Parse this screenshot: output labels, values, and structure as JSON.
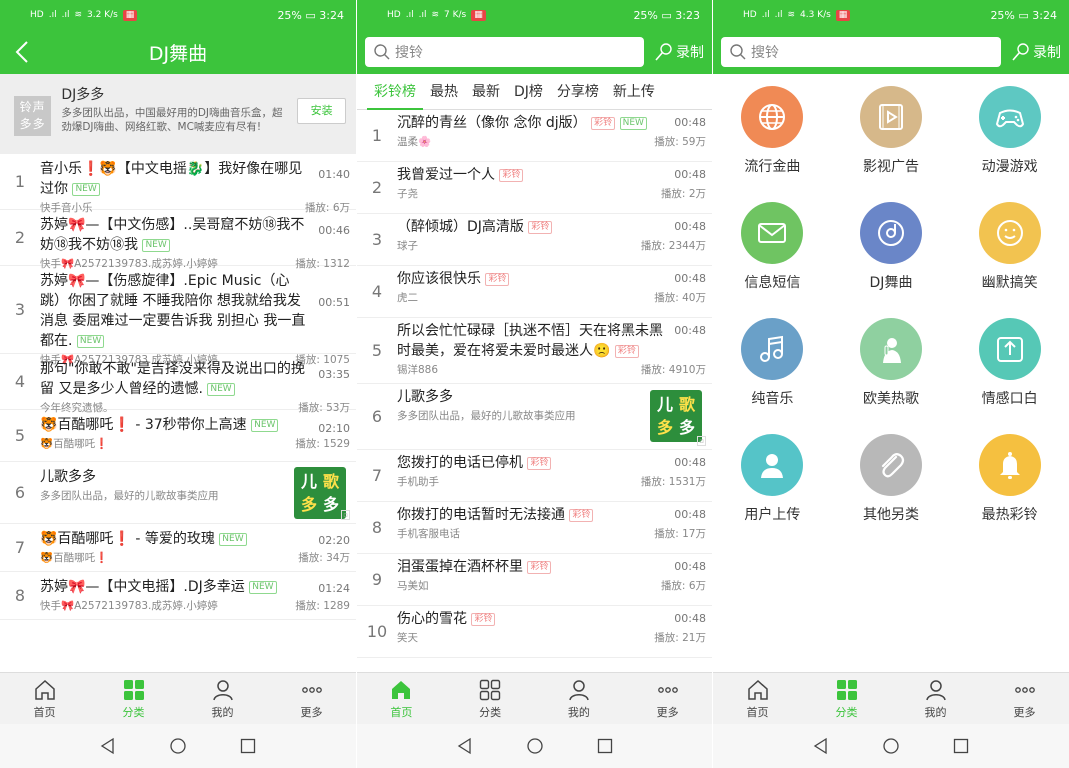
{
  "colors": {
    "brand": "#3cc43c",
    "tag_new": "#6cc46c",
    "tag_ringtone": "#f07f7f"
  },
  "statusbar": {
    "s1": {
      "speed": "3.2 K/s",
      "battery": "25%",
      "time": "3:24"
    },
    "s2": {
      "speed": "7 K/s",
      "battery": "25%",
      "time": "3:23"
    },
    "s3": {
      "speed": "4.3 K/s",
      "battery": "25%",
      "time": "3:24"
    }
  },
  "screen1": {
    "title": "DJ舞曲",
    "promo": {
      "logo_text": "铃声多多",
      "title": "DJ多多",
      "desc": "多多团队出品，中国最好用的DJ嗨曲音乐盒，超劲爆DJ嗨曲、网络红歌、MC喊麦应有尽有!",
      "install": "安装"
    },
    "items": [
      {
        "num": "1",
        "title": "音小乐❗🐯【中文电摇🐉】我好像在哪见过你",
        "tag": "NEW",
        "artist": "快手音小乐",
        "plays": "播放: 6万",
        "duration": "01:40"
      },
      {
        "num": "2",
        "title": "苏婷🎀—【中文伤感】..吴哥窟不妨⑱我不妨⑱我不妨⑱我",
        "tag": "NEW",
        "artist": "快手🎀A2572139783.成苏婷.小婷婷",
        "plays": "播放: 1312",
        "duration": "00:46"
      },
      {
        "num": "3",
        "title": "苏婷🎀—【伤感旋律】.Epic Music（心跳）你困了就睡 不睡我陪你 想我就给我发消息 委屈难过一定要告诉我 别担心 我一直都在.",
        "tag": "NEW",
        "artist": "快手🎀A2572139783.成苏婷.小婷婷",
        "plays": "播放: 1075",
        "duration": "00:51"
      },
      {
        "num": "4",
        "title": "那句\"你敢不敢\"是吉择没来得及说出口的挽留 又是多少人曾经的遗憾.",
        "tag": "NEW",
        "artist": "今年终究遗憾。",
        "plays": "播放: 53万",
        "duration": "03:35"
      },
      {
        "num": "5",
        "title": "🐯百酷哪吒❗ - 37秒带你上高速",
        "tag": "NEW",
        "artist": "🐯百酷哪吒❗",
        "plays": "播放: 1529",
        "duration": "02:10"
      },
      {
        "num": "6",
        "title": "儿歌多多",
        "tag": "",
        "artist": "多多团队出品，最好的儿歌故事类应用",
        "plays": "",
        "duration": "",
        "ad": true
      },
      {
        "num": "7",
        "title": "🐯百酷哪吒❗ - 等爱的玫瑰",
        "tag": "NEW",
        "artist": "🐯百酷哪吒❗",
        "plays": "播放: 34万",
        "duration": "02:20"
      },
      {
        "num": "8",
        "title": "苏婷🎀—【中文电摇】.DJ多幸运",
        "tag": "NEW",
        "artist": "快手🎀A2572139783.成苏婷.小婷婷",
        "plays": "播放: 1289",
        "duration": "01:24"
      }
    ]
  },
  "search": {
    "placeholder": "搜铃",
    "record": "录制"
  },
  "screen2": {
    "tabs": [
      "彩铃榜",
      "最热",
      "最新",
      "DJ榜",
      "分享榜",
      "新上传"
    ],
    "items": [
      {
        "num": "1",
        "title": "沉醉的青丝（像你 念你 dj版）",
        "tags": [
          "彩铃",
          "NEW"
        ],
        "artist": "温柔🌸",
        "plays": "播放: 59万",
        "duration": "00:48"
      },
      {
        "num": "2",
        "title": "我曾爱过一个人",
        "tags": [
          "彩铃"
        ],
        "artist": "子尧",
        "plays": "播放: 2万",
        "duration": "00:48"
      },
      {
        "num": "3",
        "title": "（醉倾城）DJ高清版",
        "tags": [
          "彩铃"
        ],
        "artist": "球子",
        "plays": "播放: 2344万",
        "duration": "00:48"
      },
      {
        "num": "4",
        "title": "你应该很快乐",
        "tags": [
          "彩铃"
        ],
        "artist": "虎二",
        "plays": "播放: 40万",
        "duration": "00:48"
      },
      {
        "num": "5",
        "title": "所以会忙忙碌碌［执迷不悟］天在将黑未黑时最美，爱在将爱未爱时最迷人🙁",
        "tags": [
          "彩铃"
        ],
        "artist": "锡洋886",
        "plays": "播放: 4910万",
        "duration": "00:48"
      },
      {
        "num": "6",
        "title": "儿歌多多",
        "tags": [],
        "artist": "多多团队出品，最好的儿歌故事类应用",
        "plays": "",
        "duration": "",
        "ad": true
      },
      {
        "num": "7",
        "title": "您拨打的电话已停机",
        "tags": [
          "彩铃"
        ],
        "artist": "手机助手",
        "plays": "播放: 1531万",
        "duration": "00:48"
      },
      {
        "num": "8",
        "title": "你拨打的电话暂时无法接通",
        "tags": [
          "彩铃"
        ],
        "artist": "手机客服电话",
        "plays": "播放: 17万",
        "duration": "00:48"
      },
      {
        "num": "9",
        "title": "泪蛋蛋掉在酒杯杯里",
        "tags": [
          "彩铃"
        ],
        "artist": "马美如",
        "plays": "播放: 6万",
        "duration": "00:48"
      },
      {
        "num": "10",
        "title": "伤心的雪花",
        "tags": [
          "彩铃"
        ],
        "artist": "笑天",
        "plays": "播放: 21万",
        "duration": "00:48"
      }
    ]
  },
  "screen3": {
    "categories": [
      {
        "label": "流行金曲",
        "icon": "globe-icon",
        "color": "#f08a55"
      },
      {
        "label": "影视广告",
        "icon": "video-icon",
        "color": "#d6b88a"
      },
      {
        "label": "动漫游戏",
        "icon": "gamepad-icon",
        "color": "#5ec8c2"
      },
      {
        "label": "信息短信",
        "icon": "mail-icon",
        "color": "#6fc462"
      },
      {
        "label": "DJ舞曲",
        "icon": "disc-icon",
        "color": "#6a86c8"
      },
      {
        "label": "幽默搞笑",
        "icon": "smile-icon",
        "color": "#f2c350"
      },
      {
        "label": "纯音乐",
        "icon": "music-note-icon",
        "color": "#6aa0c8"
      },
      {
        "label": "欧美热歌",
        "icon": "singer-icon",
        "color": "#8fd0a0"
      },
      {
        "label": "情感口白",
        "icon": "share-box-icon",
        "color": "#56c8b6"
      },
      {
        "label": "用户上传",
        "icon": "user-icon",
        "color": "#55c4c8"
      },
      {
        "label": "其他另类",
        "icon": "paperclip-icon",
        "color": "#b8b8b8"
      },
      {
        "label": "最热彩铃",
        "icon": "bell-icon",
        "color": "#f5c040"
      }
    ]
  },
  "bottomnav": {
    "home": "首页",
    "category": "分类",
    "mine": "我的",
    "more": "更多"
  }
}
